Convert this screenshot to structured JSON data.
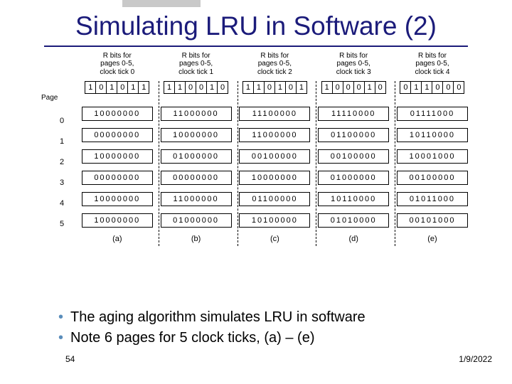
{
  "title": "Simulating LRU in Software (2)",
  "figure": {
    "page_word": "Page",
    "page_numbers": [
      "0",
      "1",
      "2",
      "3",
      "4",
      "5"
    ],
    "columns": [
      {
        "head": "R bits for\npages 0-5,\nclock tick 0",
        "rbits": [
          "1",
          "0",
          "1",
          "0",
          "1",
          "1"
        ],
        "counters": [
          "10000000",
          "00000000",
          "10000000",
          "00000000",
          "10000000",
          "10000000"
        ],
        "caption": "(a)"
      },
      {
        "head": "R bits for\npages 0-5,\nclock tick 1",
        "rbits": [
          "1",
          "1",
          "0",
          "0",
          "1",
          "0"
        ],
        "counters": [
          "11000000",
          "10000000",
          "01000000",
          "00000000",
          "11000000",
          "01000000"
        ],
        "caption": "(b)"
      },
      {
        "head": "R bits for\npages 0-5,\nclock tick 2",
        "rbits": [
          "1",
          "1",
          "0",
          "1",
          "0",
          "1"
        ],
        "counters": [
          "11100000",
          "11000000",
          "00100000",
          "10000000",
          "01100000",
          "10100000"
        ],
        "caption": "(c)"
      },
      {
        "head": "R bits for\npages 0-5,\nclock tick 3",
        "rbits": [
          "1",
          "0",
          "0",
          "0",
          "1",
          "0"
        ],
        "counters": [
          "11110000",
          "01100000",
          "00100000",
          "01000000",
          "10110000",
          "01010000"
        ],
        "caption": "(d)"
      },
      {
        "head": "R bits for\npages 0-5,\nclock tick 4",
        "rbits": [
          "0",
          "1",
          "1",
          "0",
          "0",
          "0"
        ],
        "counters": [
          "01111000",
          "10110000",
          "10001000",
          "00100000",
          "01011000",
          "00101000"
        ],
        "caption": "(e)"
      }
    ]
  },
  "bullets": [
    "The aging algorithm simulates LRU in software",
    "Note 6 pages for 5 clock ticks, (a) – (e)"
  ],
  "slide_number": "54",
  "date": "1/9/2022"
}
